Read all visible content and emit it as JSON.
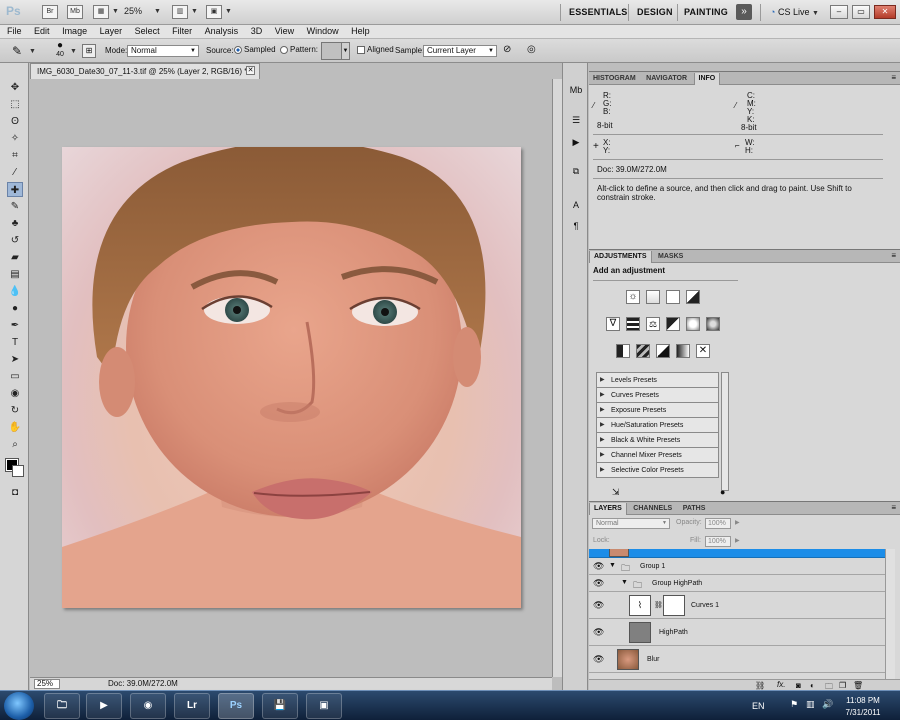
{
  "app": {
    "logo": "Ps",
    "bridge_icon": "Br",
    "minibridge_icon": "Mb",
    "zoom": "25%",
    "workspaces": [
      "ESSENTIALS",
      "DESIGN",
      "PAINTING"
    ],
    "more_workspaces": "»",
    "cs_live": "CS Live"
  },
  "window_buttons": {
    "minimize": "–",
    "restore": "▭",
    "close": "✕"
  },
  "menu": [
    "File",
    "Edit",
    "Image",
    "Layer",
    "Select",
    "Filter",
    "Analysis",
    "3D",
    "View",
    "Window",
    "Help"
  ],
  "options": {
    "brush_size": "40",
    "mode_label": "Mode:",
    "mode_value": "Normal",
    "source_label": "Source:",
    "sampled_label": "Sampled",
    "pattern_label": "Pattern:",
    "aligned_label": "Aligned",
    "sample_label": "Sample:",
    "sample_value": "Current Layer"
  },
  "document": {
    "tab_title": "IMG_6030_Date30_07_11-3.tif @ 25% (Layer 2, RGB/16) *",
    "close": "✕",
    "zoom": "25%",
    "doc_size": "Doc: 39.0M/272.0M"
  },
  "info_panel": {
    "tabs": [
      "HISTOGRAM",
      "NAVIGATOR",
      "INFO"
    ],
    "active_tab": "INFO",
    "rgb_labels": [
      "R:",
      "G:",
      "B:"
    ],
    "cmyk_labels": [
      "C:",
      "M:",
      "Y:",
      "K:"
    ],
    "bit_left": "8-bit",
    "bit_right": "8-bit",
    "xy_labels": [
      "X:",
      "Y:"
    ],
    "wh_labels": [
      "W:",
      "H:"
    ],
    "doc_size": "Doc: 39.0M/272.0M",
    "hint": "Alt-click to define a source, and then click and drag to paint. Use Shift to constrain stroke."
  },
  "adjustments_panel": {
    "tabs": [
      "ADJUSTMENTS",
      "MASKS"
    ],
    "active_tab": "ADJUSTMENTS",
    "heading": "Add an adjustment",
    "presets": [
      "Levels Presets",
      "Curves Presets",
      "Exposure Presets",
      "Hue/Saturation Presets",
      "Black & White Presets",
      "Channel Mixer Presets",
      "Selective Color Presets"
    ]
  },
  "layers_panel": {
    "tabs": [
      "LAYERS",
      "CHANNELS",
      "PATHS"
    ],
    "active_tab": "LAYERS",
    "blend_mode": "Normal",
    "opacity_label": "Opacity:",
    "opacity_value": "100%",
    "lock_label": "Lock:",
    "fill_label": "Fill:",
    "fill_value": "100%",
    "layers": [
      {
        "name": "Group 1"
      },
      {
        "name": "Group HighPath"
      },
      {
        "name": "Curves 1"
      },
      {
        "name": "HighPath"
      },
      {
        "name": "Blur"
      }
    ],
    "footer_icons": [
      "link-icon",
      "fx-icon",
      "mask-icon",
      "adjustment-icon",
      "folder-icon",
      "new-layer-icon",
      "trash-icon"
    ]
  },
  "taskbar": {
    "items": [
      "Explorer",
      "Media Player",
      "Chrome",
      "Lr",
      "Ps",
      "Save",
      "Remote"
    ],
    "active_item": "Ps",
    "lang": "EN",
    "time": "11:08 PM",
    "date": "7/31/2011"
  }
}
